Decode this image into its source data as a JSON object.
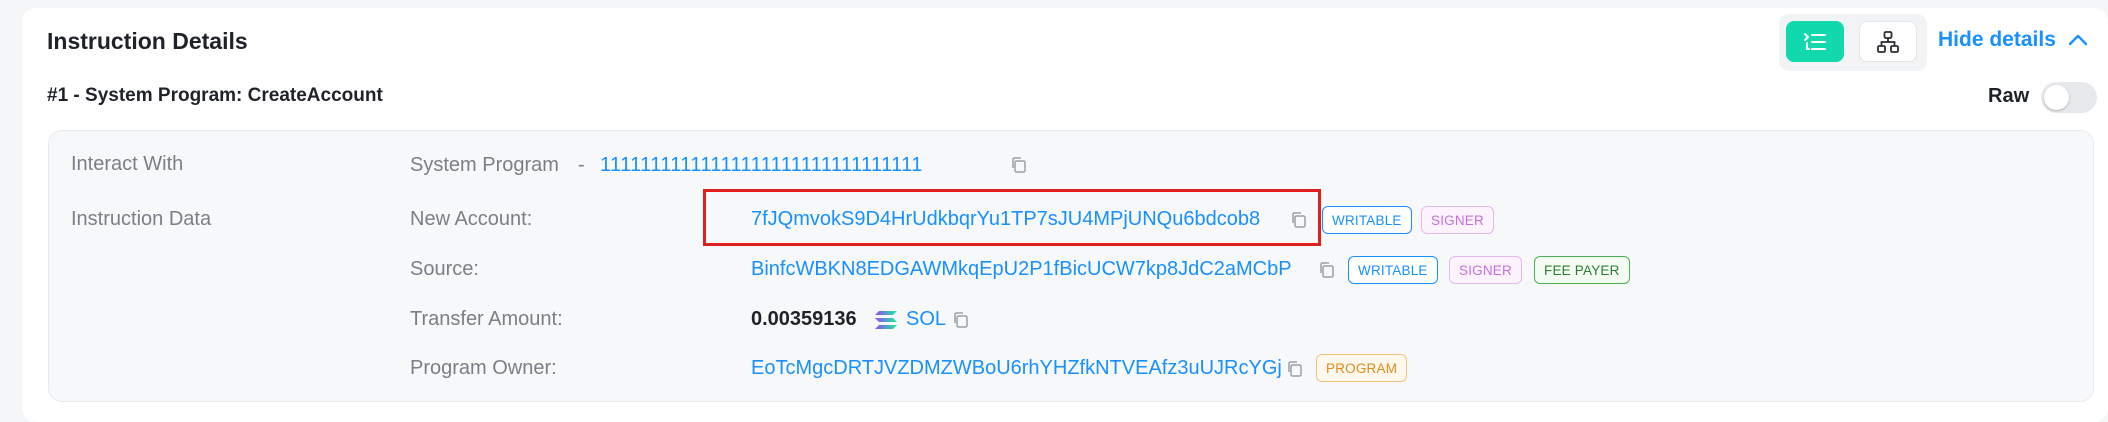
{
  "card": {
    "title": "Instruction Details",
    "hide_details_label": "Hide details",
    "view_modes": [
      {
        "name": "list",
        "icon": "list-icon",
        "active": true
      },
      {
        "name": "tree",
        "icon": "hierarchy-icon",
        "active": false
      }
    ],
    "accent_color": "#12d9ad",
    "link_color": "#1890ff"
  },
  "instruction": {
    "heading": "#1 - System Program: CreateAccount",
    "raw_label": "Raw",
    "raw_enabled": false,
    "interact_with": {
      "label": "Interact With",
      "program_name": "System Program",
      "separator": "-",
      "program_address": "11111111111111111111111111111111"
    },
    "instruction_data_label": "Instruction Data",
    "fields": {
      "new_account": {
        "label": "New Account:",
        "value": "7fJQmvokS9D4HrUdkbqrYu1TP7sJU4MPjUNQu6bdcob8",
        "badges": [
          "WRITABLE",
          "SIGNER"
        ]
      },
      "source": {
        "label": "Source:",
        "value": "BinfcWBKN8EDGAWMkqEpU2P1fBicUCW7kp8JdC2aMCbP",
        "badges": [
          "WRITABLE",
          "SIGNER",
          "FEE PAYER"
        ]
      },
      "transfer_amount": {
        "label": "Transfer Amount:",
        "amount": "0.00359136",
        "token": "SOL",
        "token_icon": "solana-icon"
      },
      "program_owner": {
        "label": "Program Owner:",
        "value": "EoTcMgcDRTJVZDMZWBoU6rhYHZfkNTVEAfz3uUJRcYGj",
        "badges": [
          "PROGRAM"
        ]
      }
    }
  }
}
